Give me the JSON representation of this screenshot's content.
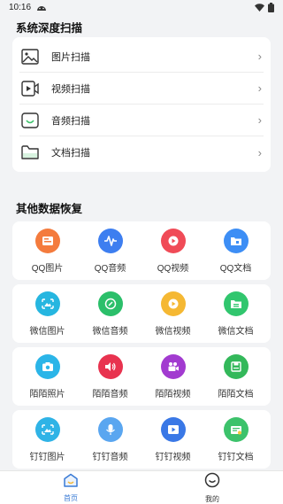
{
  "status_bar": {
    "time": "10:16"
  },
  "system_scan": {
    "title": "系统深度扫描",
    "items": [
      {
        "label": "图片扫描",
        "icon": "image-icon"
      },
      {
        "label": "视频扫描",
        "icon": "video-icon"
      },
      {
        "label": "音频扫描",
        "icon": "audio-icon"
      },
      {
        "label": "文档扫描",
        "icon": "folder-icon"
      }
    ]
  },
  "other_recovery": {
    "title": "其他数据恢复",
    "groups": [
      [
        {
          "label": "QQ图片",
          "icon": "qq-image-icon",
          "color": "#f47b3d"
        },
        {
          "label": "QQ音频",
          "icon": "qq-audio-icon",
          "color": "#3d7ef0"
        },
        {
          "label": "QQ视频",
          "icon": "qq-video-icon",
          "color": "#f04b57"
        },
        {
          "label": "QQ文档",
          "icon": "qq-doc-icon",
          "color": "#3d8ef5"
        }
      ],
      [
        {
          "label": "微信图片",
          "icon": "wechat-image-icon",
          "color": "#26b6e0"
        },
        {
          "label": "微信音频",
          "icon": "wechat-audio-icon",
          "color": "#2bbf6a"
        },
        {
          "label": "微信视频",
          "icon": "wechat-video-icon",
          "color": "#f5b833"
        },
        {
          "label": "微信文档",
          "icon": "wechat-doc-icon",
          "color": "#31c66e"
        }
      ],
      [
        {
          "label": "陌陌照片",
          "icon": "momo-photo-icon",
          "color": "#2bb5e8"
        },
        {
          "label": "陌陌音频",
          "icon": "momo-audio-icon",
          "color": "#e8334f"
        },
        {
          "label": "陌陌视频",
          "icon": "momo-video-icon",
          "color": "#a23bd0"
        },
        {
          "label": "陌陌文档",
          "icon": "momo-doc-icon",
          "color": "#33b85a"
        }
      ],
      [
        {
          "label": "钉钉图片",
          "icon": "dingtalk-image-icon",
          "color": "#2fb3e6"
        },
        {
          "label": "钉钉音频",
          "icon": "dingtalk-audio-icon",
          "color": "#5aa6f0"
        },
        {
          "label": "钉钉视频",
          "icon": "dingtalk-video-icon",
          "color": "#3a78e6"
        },
        {
          "label": "钉钉文档",
          "icon": "dingtalk-doc-icon",
          "color": "#3cc26b"
        }
      ]
    ]
  },
  "bottom_nav": {
    "home": "首页",
    "mine": "我的",
    "accent": "#3a7bd5"
  }
}
